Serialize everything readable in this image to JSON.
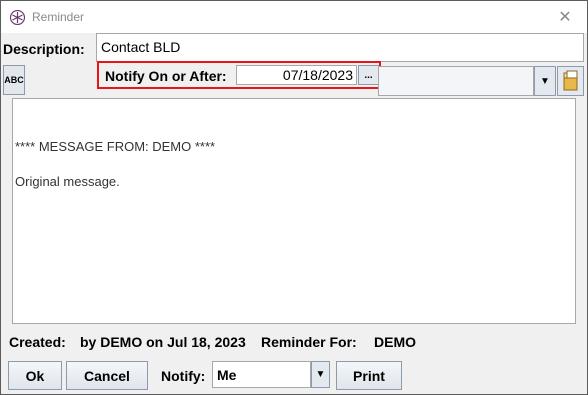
{
  "window": {
    "title": "Reminder",
    "close_glyph": "✕",
    "app_icon": "reminder-app-icon"
  },
  "description": {
    "label": "Description:",
    "value": "Contact BLD"
  },
  "toolbar": {
    "spellcheck_label": "ABC",
    "notify_on_label": "Notify On or After:",
    "date_value": "07/18/2023",
    "date_button_label": "...",
    "dropdown_arrow": "▼",
    "folder_icon": "folder-icon"
  },
  "message": {
    "lines": [
      "**** MESSAGE FROM: DEMO ****",
      "Original message."
    ]
  },
  "footer": {
    "created_label": "Created:",
    "created_value": "by DEMO on Jul 18, 2023",
    "reminder_for_label": "Reminder For:",
    "reminder_for_value": "DEMO"
  },
  "buttons": {
    "ok": "Ok",
    "cancel": "Cancel",
    "notify_label": "Notify:",
    "notify_value": "Me",
    "print": "Print"
  },
  "colors": {
    "highlight_border": "#e8141c"
  }
}
